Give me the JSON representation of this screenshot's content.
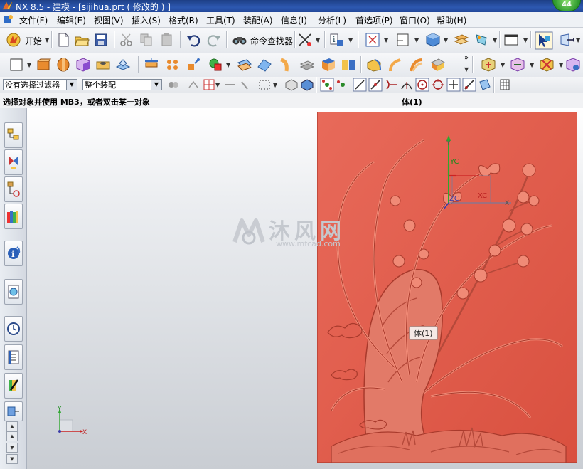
{
  "window": {
    "title": "NX 8.5 - 建模 - [sijihua.prt  ( 修改的 ) ]",
    "badge": "44"
  },
  "menu": {
    "items": [
      {
        "label": "文件(F)"
      },
      {
        "label": "编辑(E)"
      },
      {
        "label": "视图(V)"
      },
      {
        "label": "插入(S)"
      },
      {
        "label": "格式(R)"
      },
      {
        "label": "工具(T)"
      },
      {
        "label": "装配(A)"
      },
      {
        "label": "信息(I)"
      },
      {
        "label": "分析(L)"
      },
      {
        "label": "首选项(P)"
      },
      {
        "label": "窗口(O)"
      },
      {
        "label": "帮助(H)"
      }
    ]
  },
  "toolbar": {
    "start_label": "开始",
    "command_finder_label": "命令查找器"
  },
  "selection_bar": {
    "filter_value": "没有选择过滤器",
    "scope_value": "整个装配"
  },
  "status": {
    "prompt": "选择对象并使用 MB3，或者双击某一对象",
    "selection": "体(1)"
  },
  "viewport": {
    "tooltip": "体(1)",
    "watermark_brand": "沐风网",
    "watermark_url": "www.mfcad.com",
    "panel_color": "#e15a4a",
    "csys_labels": {
      "yc": "YC",
      "xc": "XC",
      "zc": "ZC",
      "y": "Y",
      "x": "X"
    },
    "wcs_labels": {
      "x": "X",
      "y": "Y"
    }
  },
  "icons": [
    "nx-logo-icon",
    "start-icon",
    "new-file-icon",
    "open-file-icon",
    "save-icon",
    "cut-icon",
    "copy-icon",
    "paste-icon",
    "undo-icon",
    "redo-icon",
    "binoculars-icon",
    "snap-icon",
    "info-icon",
    "fit-view-icon",
    "section-view-icon",
    "shaded-cube-icon",
    "layer-icon",
    "wcs-icon",
    "display-mode-icon",
    "selection-arrow-icon",
    "orient-icon"
  ],
  "accent_colors": {
    "title_bar": "#22489a",
    "panel": "#e15a4a"
  }
}
